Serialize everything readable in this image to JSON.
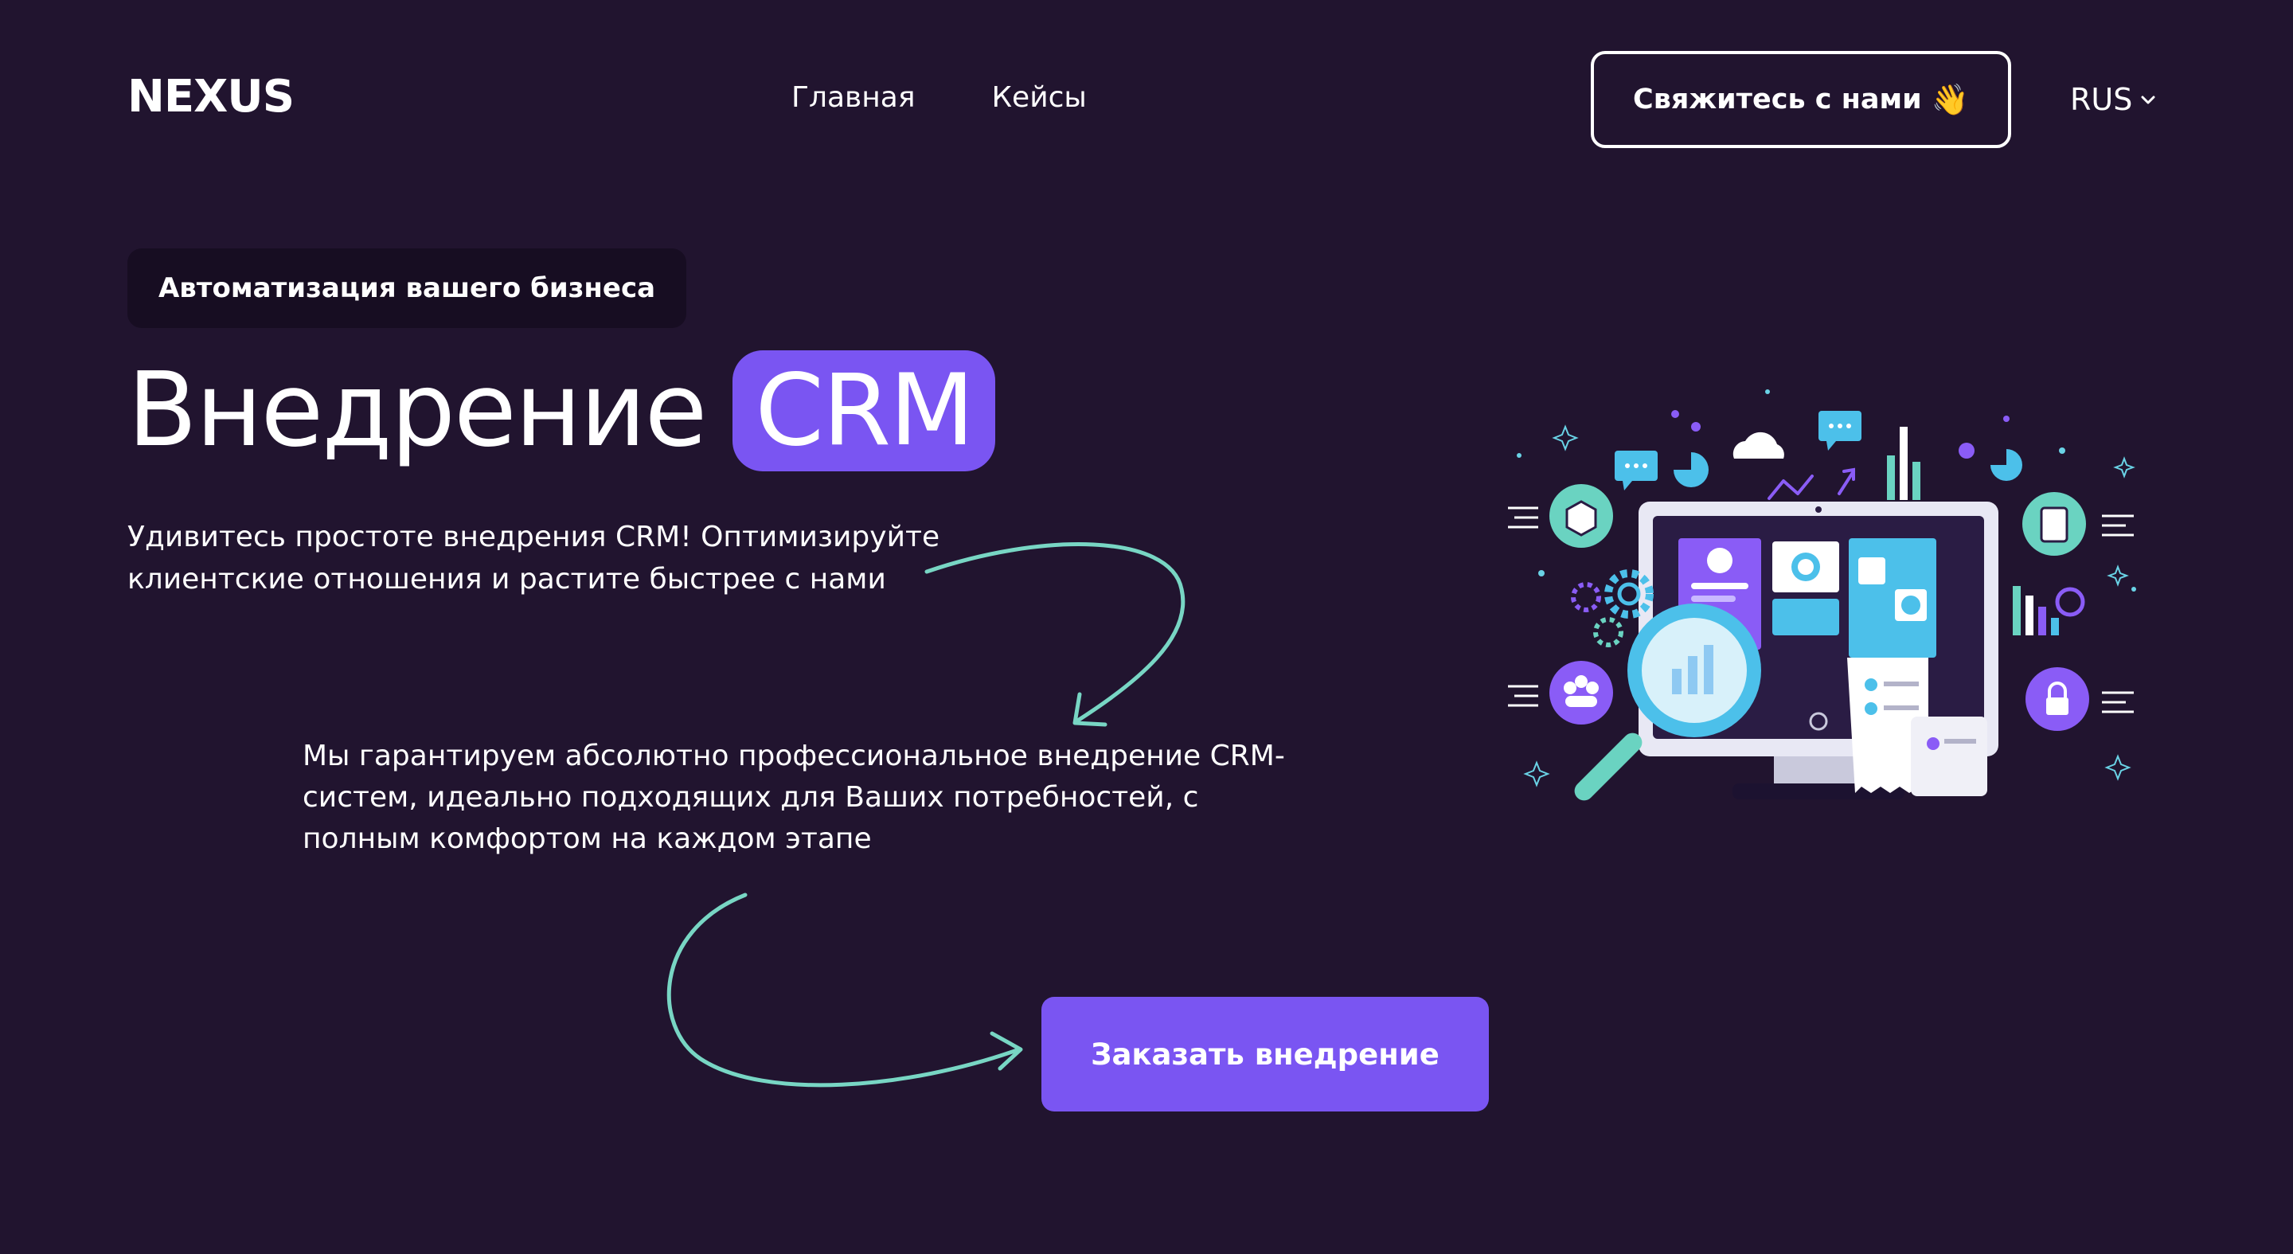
{
  "header": {
    "logo": "NEXUS",
    "nav": [
      "Главная",
      "Кейсы"
    ],
    "contact_label": "Свяжитесь с нами",
    "contact_emoji": "👋",
    "language": "RUS"
  },
  "hero": {
    "tag": "Автоматизация вашего бизнеса",
    "title_word": "Внедрение",
    "title_highlight": "CRM",
    "description_1": "Удивитесь простоте внедрения CRM! Оптимизируйте клиентские отношения и растите быстрее с нами",
    "description_2": "Мы гарантируем абсолютно профессиональное внедрение CRM-систем, идеально подходящих для Ваших потребностей, с полным комфортом на каждом этапе",
    "cta_label": "Заказать внедрение"
  },
  "colors": {
    "background": "#21142f",
    "accent": "#7a55f2",
    "tag_bg": "#170d22",
    "arrow": "#78d6c4"
  },
  "illustration": {
    "icon": "crm-dashboard-illustration"
  }
}
